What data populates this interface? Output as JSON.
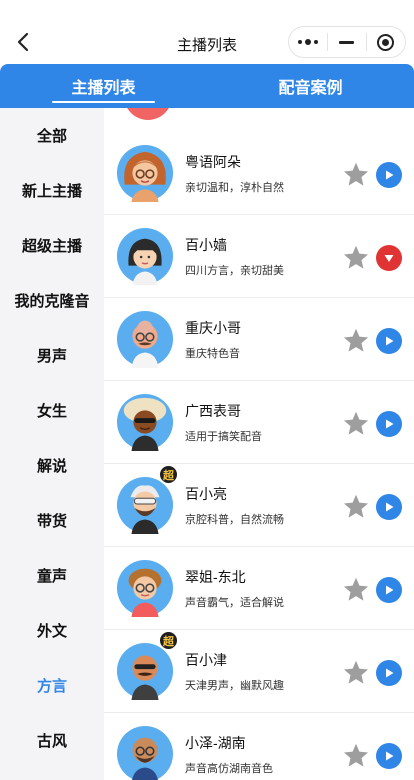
{
  "header": {
    "title": "主播列表",
    "back_icon": "chevron-left-icon",
    "menu_icon": "more-dots-icon",
    "minimize_icon": "minus-icon",
    "close_icon": "target-icon"
  },
  "tabs": [
    {
      "label": "主播列表",
      "active": true
    },
    {
      "label": "配音案例",
      "active": false
    }
  ],
  "colors": {
    "accent": "#2f86e7",
    "play_blue": "#2f86e7",
    "play_red": "#e03434",
    "star_gray": "#9e9e9e",
    "sidebar_bg": "#f4f4f6"
  },
  "sidebar": {
    "active_index": 11,
    "items": [
      {
        "label": "全部"
      },
      {
        "label": "新上主播"
      },
      {
        "label": "超级主播"
      },
      {
        "label": "我的克隆音"
      },
      {
        "label": "男声"
      },
      {
        "label": "女生"
      },
      {
        "label": "解说"
      },
      {
        "label": "带货"
      },
      {
        "label": "童声"
      },
      {
        "label": "外文"
      },
      {
        "label": "方言"
      },
      {
        "label": "古风"
      }
    ]
  },
  "voices": [
    {
      "name": "粤语阿朵",
      "desc": "亲切温和，淳朴自然",
      "badge": "",
      "button": "play",
      "avatar": "woman-orange-hair-glasses"
    },
    {
      "name": "百小嫱",
      "desc": "四川方言，亲切甜美",
      "badge": "",
      "button": "pause",
      "avatar": "woman-black-bob"
    },
    {
      "name": "重庆小哥",
      "desc": "重庆特色音",
      "badge": "",
      "button": "play",
      "avatar": "man-bald-glasses-mustache"
    },
    {
      "name": "广西表哥",
      "desc": "适用于搞笑配音",
      "badge": "",
      "button": "play",
      "avatar": "man-afro-sunglasses"
    },
    {
      "name": "百小亮",
      "desc": "京腔科普，自然流畅",
      "badge": "超",
      "button": "play",
      "avatar": "man-white-hair-beard"
    },
    {
      "name": "翠姐-东北",
      "desc": "声音霸气，适合解说",
      "badge": "",
      "button": "play",
      "avatar": "woman-curly-glasses"
    },
    {
      "name": "百小津",
      "desc": "天津男声，幽默风趣",
      "badge": "超",
      "button": "play",
      "avatar": "man-bald-sunglasses-mustache"
    },
    {
      "name": "小泽-湖南",
      "desc": "声音高仿湖南音色",
      "badge": "",
      "button": "play",
      "avatar": "man-bald-glasses-beard"
    }
  ]
}
